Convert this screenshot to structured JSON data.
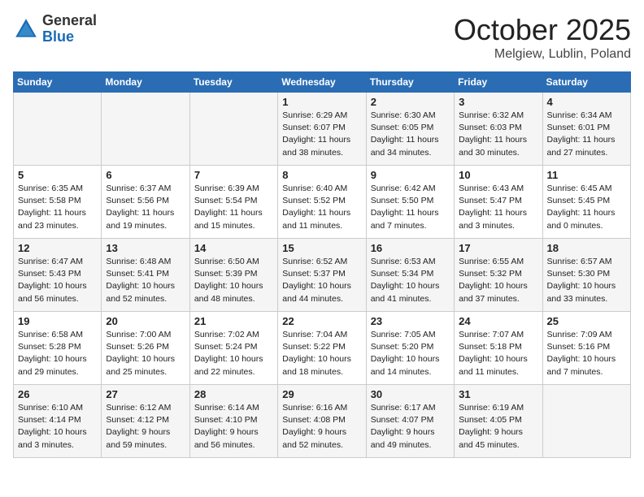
{
  "logo": {
    "general": "General",
    "blue": "Blue"
  },
  "title": "October 2025",
  "location": "Melgiew, Lublin, Poland",
  "days_of_week": [
    "Sunday",
    "Monday",
    "Tuesday",
    "Wednesday",
    "Thursday",
    "Friday",
    "Saturday"
  ],
  "weeks": [
    [
      {
        "day": "",
        "content": ""
      },
      {
        "day": "",
        "content": ""
      },
      {
        "day": "",
        "content": ""
      },
      {
        "day": "1",
        "content": "Sunrise: 6:29 AM\nSunset: 6:07 PM\nDaylight: 11 hours\nand 38 minutes."
      },
      {
        "day": "2",
        "content": "Sunrise: 6:30 AM\nSunset: 6:05 PM\nDaylight: 11 hours\nand 34 minutes."
      },
      {
        "day": "3",
        "content": "Sunrise: 6:32 AM\nSunset: 6:03 PM\nDaylight: 11 hours\nand 30 minutes."
      },
      {
        "day": "4",
        "content": "Sunrise: 6:34 AM\nSunset: 6:01 PM\nDaylight: 11 hours\nand 27 minutes."
      }
    ],
    [
      {
        "day": "5",
        "content": "Sunrise: 6:35 AM\nSunset: 5:58 PM\nDaylight: 11 hours\nand 23 minutes."
      },
      {
        "day": "6",
        "content": "Sunrise: 6:37 AM\nSunset: 5:56 PM\nDaylight: 11 hours\nand 19 minutes."
      },
      {
        "day": "7",
        "content": "Sunrise: 6:39 AM\nSunset: 5:54 PM\nDaylight: 11 hours\nand 15 minutes."
      },
      {
        "day": "8",
        "content": "Sunrise: 6:40 AM\nSunset: 5:52 PM\nDaylight: 11 hours\nand 11 minutes."
      },
      {
        "day": "9",
        "content": "Sunrise: 6:42 AM\nSunset: 5:50 PM\nDaylight: 11 hours\nand 7 minutes."
      },
      {
        "day": "10",
        "content": "Sunrise: 6:43 AM\nSunset: 5:47 PM\nDaylight: 11 hours\nand 3 minutes."
      },
      {
        "day": "11",
        "content": "Sunrise: 6:45 AM\nSunset: 5:45 PM\nDaylight: 11 hours\nand 0 minutes."
      }
    ],
    [
      {
        "day": "12",
        "content": "Sunrise: 6:47 AM\nSunset: 5:43 PM\nDaylight: 10 hours\nand 56 minutes."
      },
      {
        "day": "13",
        "content": "Sunrise: 6:48 AM\nSunset: 5:41 PM\nDaylight: 10 hours\nand 52 minutes."
      },
      {
        "day": "14",
        "content": "Sunrise: 6:50 AM\nSunset: 5:39 PM\nDaylight: 10 hours\nand 48 minutes."
      },
      {
        "day": "15",
        "content": "Sunrise: 6:52 AM\nSunset: 5:37 PM\nDaylight: 10 hours\nand 44 minutes."
      },
      {
        "day": "16",
        "content": "Sunrise: 6:53 AM\nSunset: 5:34 PM\nDaylight: 10 hours\nand 41 minutes."
      },
      {
        "day": "17",
        "content": "Sunrise: 6:55 AM\nSunset: 5:32 PM\nDaylight: 10 hours\nand 37 minutes."
      },
      {
        "day": "18",
        "content": "Sunrise: 6:57 AM\nSunset: 5:30 PM\nDaylight: 10 hours\nand 33 minutes."
      }
    ],
    [
      {
        "day": "19",
        "content": "Sunrise: 6:58 AM\nSunset: 5:28 PM\nDaylight: 10 hours\nand 29 minutes."
      },
      {
        "day": "20",
        "content": "Sunrise: 7:00 AM\nSunset: 5:26 PM\nDaylight: 10 hours\nand 25 minutes."
      },
      {
        "day": "21",
        "content": "Sunrise: 7:02 AM\nSunset: 5:24 PM\nDaylight: 10 hours\nand 22 minutes."
      },
      {
        "day": "22",
        "content": "Sunrise: 7:04 AM\nSunset: 5:22 PM\nDaylight: 10 hours\nand 18 minutes."
      },
      {
        "day": "23",
        "content": "Sunrise: 7:05 AM\nSunset: 5:20 PM\nDaylight: 10 hours\nand 14 minutes."
      },
      {
        "day": "24",
        "content": "Sunrise: 7:07 AM\nSunset: 5:18 PM\nDaylight: 10 hours\nand 11 minutes."
      },
      {
        "day": "25",
        "content": "Sunrise: 7:09 AM\nSunset: 5:16 PM\nDaylight: 10 hours\nand 7 minutes."
      }
    ],
    [
      {
        "day": "26",
        "content": "Sunrise: 6:10 AM\nSunset: 4:14 PM\nDaylight: 10 hours\nand 3 minutes."
      },
      {
        "day": "27",
        "content": "Sunrise: 6:12 AM\nSunset: 4:12 PM\nDaylight: 9 hours\nand 59 minutes."
      },
      {
        "day": "28",
        "content": "Sunrise: 6:14 AM\nSunset: 4:10 PM\nDaylight: 9 hours\nand 56 minutes."
      },
      {
        "day": "29",
        "content": "Sunrise: 6:16 AM\nSunset: 4:08 PM\nDaylight: 9 hours\nand 52 minutes."
      },
      {
        "day": "30",
        "content": "Sunrise: 6:17 AM\nSunset: 4:07 PM\nDaylight: 9 hours\nand 49 minutes."
      },
      {
        "day": "31",
        "content": "Sunrise: 6:19 AM\nSunset: 4:05 PM\nDaylight: 9 hours\nand 45 minutes."
      },
      {
        "day": "",
        "content": ""
      }
    ]
  ]
}
